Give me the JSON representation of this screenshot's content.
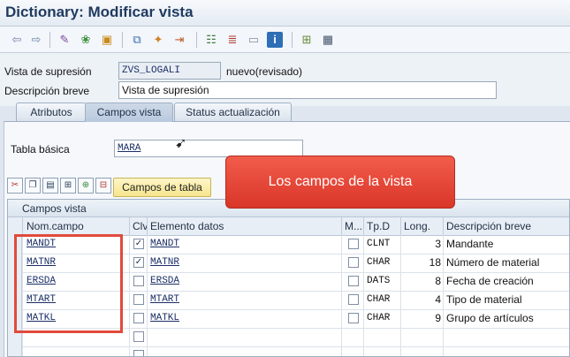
{
  "window": {
    "title": "Dictionary: Modificar vista"
  },
  "toolbar": {
    "icons": [
      "arrow-left-icon",
      "arrow-right-icon",
      "display-change-icon",
      "other-object-icon",
      "activate-icon",
      "hierarchy-icon",
      "where-used-icon",
      "transport-icon",
      "tree-icon",
      "align-icon",
      "layout-icon",
      "info-icon",
      "grid-icon",
      "table-icon"
    ]
  },
  "header": {
    "view_label": "Vista de supresión",
    "view_value": "ZVS_LOGALI",
    "view_status": "nuevo(revisado)",
    "desc_label": "Descripción breve",
    "desc_value": "Vista de supresión"
  },
  "tabs": [
    {
      "label": "Atributos"
    },
    {
      "label": "Campos vista"
    },
    {
      "label": "Status actualización"
    }
  ],
  "basic_table": {
    "label": "Tabla básica",
    "value": "MARA"
  },
  "buttons": {
    "campos_de_tabla": "Campos de tabla"
  },
  "grid": {
    "title": "Campos vista",
    "columns": [
      "Nom.campo",
      "Clv",
      "Elemento datos",
      "M...",
      "Tp.D",
      "Long.",
      "Descripción breve"
    ],
    "rows": [
      {
        "field": "MANDT",
        "key": true,
        "element": "MANDT",
        "m": false,
        "type": "CLNT",
        "len": "3",
        "desc": "Mandante"
      },
      {
        "field": "MATNR",
        "key": true,
        "element": "MATNR",
        "m": false,
        "type": "CHAR",
        "len": "18",
        "desc": "Número de material"
      },
      {
        "field": "ERSDA",
        "key": false,
        "element": "ERSDA",
        "m": false,
        "type": "DATS",
        "len": "8",
        "desc": "Fecha de creación"
      },
      {
        "field": "MTART",
        "key": false,
        "element": "MTART",
        "m": false,
        "type": "CHAR",
        "len": "4",
        "desc": "Tipo de material"
      },
      {
        "field": "MATKL",
        "key": false,
        "element": "MATKL",
        "m": false,
        "type": "CHAR",
        "len": "9",
        "desc": "Grupo de artículos"
      }
    ],
    "empty_rows": 2
  },
  "annotation": {
    "text": "Los campos de la vista",
    "color": "#e04a3b"
  }
}
